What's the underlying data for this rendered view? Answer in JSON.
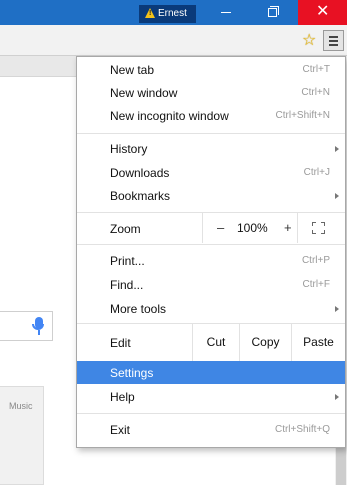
{
  "titlebar": {
    "profile_name": "Ernest"
  },
  "toolbar": {
    "bookmark_icon": "star-icon",
    "menu_icon": "hamburger-icon"
  },
  "page": {
    "tile_label": "Music"
  },
  "menu": {
    "new_tab": {
      "label": "New tab",
      "shortcut": "Ctrl+T"
    },
    "new_window": {
      "label": "New window",
      "shortcut": "Ctrl+N"
    },
    "new_incognito": {
      "label": "New incognito window",
      "shortcut": "Ctrl+Shift+N"
    },
    "history": {
      "label": "History"
    },
    "downloads": {
      "label": "Downloads",
      "shortcut": "Ctrl+J"
    },
    "bookmarks": {
      "label": "Bookmarks"
    },
    "zoom": {
      "label": "Zoom",
      "minus": "–",
      "value": "100%",
      "plus": "+"
    },
    "print": {
      "label": "Print...",
      "shortcut": "Ctrl+P"
    },
    "find": {
      "label": "Find...",
      "shortcut": "Ctrl+F"
    },
    "more_tools": {
      "label": "More tools"
    },
    "edit": {
      "label": "Edit",
      "cut": "Cut",
      "copy": "Copy",
      "paste": "Paste"
    },
    "settings": {
      "label": "Settings"
    },
    "help": {
      "label": "Help"
    },
    "exit": {
      "label": "Exit",
      "shortcut": "Ctrl+Shift+Q"
    }
  },
  "colors": {
    "titlebar": "#1f6fc5",
    "close_button": "#e81123",
    "highlight": "#3f86e4"
  }
}
